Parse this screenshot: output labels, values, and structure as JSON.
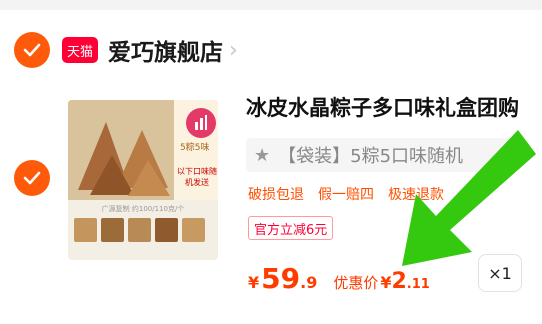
{
  "store": {
    "badge_label": "天猫",
    "name": "爱巧旗舰店",
    "chevron": "›"
  },
  "product": {
    "thumbnail": {
      "side_top_text": "5粽5味",
      "side_text": "以下口味随机发送",
      "caption": "广源复制 约100/110克/个"
    },
    "title": "冰皮水晶粽子多口味礼盒团购",
    "sku": {
      "star": "★",
      "label": "【袋装】5粽5口味随机"
    },
    "tags": [
      "破损包退",
      "假一赔四",
      "极速退款"
    ],
    "promo": "官方立减6元",
    "price": {
      "symbol": "¥",
      "main": "59",
      "decimal": ".9"
    },
    "discount": {
      "label": "优惠价",
      "symbol": "¥",
      "main": "2",
      "decimal": ".11"
    },
    "quantity": "×1"
  },
  "colors": {
    "accent": "#ff5a0a",
    "price": "#ff3c00",
    "tmall": "#ff0036",
    "arrow": "#34c90f"
  },
  "icons": [
    "check-icon",
    "tmall-icon",
    "chevron-right-icon",
    "star-icon",
    "green-arrow-icon"
  ]
}
